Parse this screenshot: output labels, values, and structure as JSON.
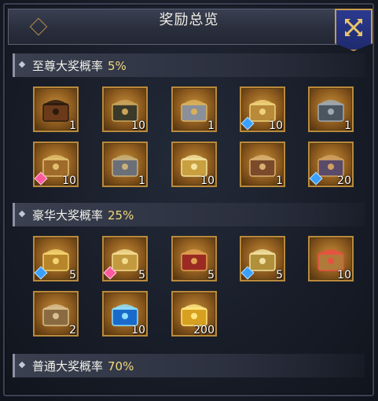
{
  "title": "奖励总览",
  "sections": [
    {
      "label": "至尊大奖概率",
      "percent": "5%",
      "items": [
        {
          "icon": "skull-chest-icon",
          "qty": "1"
        },
        {
          "icon": "warrior-portrait-icon",
          "qty": "10"
        },
        {
          "icon": "gold-treasure-pile-icon",
          "qty": "1"
        },
        {
          "icon": "treasure-chest-icon",
          "qty": "10"
        },
        {
          "icon": "armor-set-icon",
          "qty": "1"
        },
        {
          "icon": "hero-chest-icon",
          "qty": "10"
        },
        {
          "icon": "armor-pile-icon",
          "qty": "1"
        },
        {
          "icon": "golden-box-icon",
          "qty": "10"
        },
        {
          "icon": "ornate-chest-icon",
          "qty": "1"
        },
        {
          "icon": "dragon-chest-icon",
          "qty": "20"
        }
      ]
    },
    {
      "label": "豪华大奖概率",
      "percent": "25%",
      "items": [
        {
          "icon": "gold-chest-icon",
          "qty": "5"
        },
        {
          "icon": "money-bag-icon",
          "qty": "5"
        },
        {
          "icon": "red-chest-icon",
          "qty": "5"
        },
        {
          "icon": "scroll-chest-icon",
          "qty": "5"
        },
        {
          "icon": "rune-pouch-icon",
          "qty": "10"
        },
        {
          "icon": "scroll-bundle-icon",
          "qty": "2"
        },
        {
          "icon": "blue-crystal-icon",
          "qty": "10"
        },
        {
          "icon": "gold-ingot-icon",
          "qty": "200"
        }
      ]
    },
    {
      "label": "普通大奖概率",
      "percent": "70%",
      "items": []
    }
  ],
  "close_icon": "close-icon"
}
